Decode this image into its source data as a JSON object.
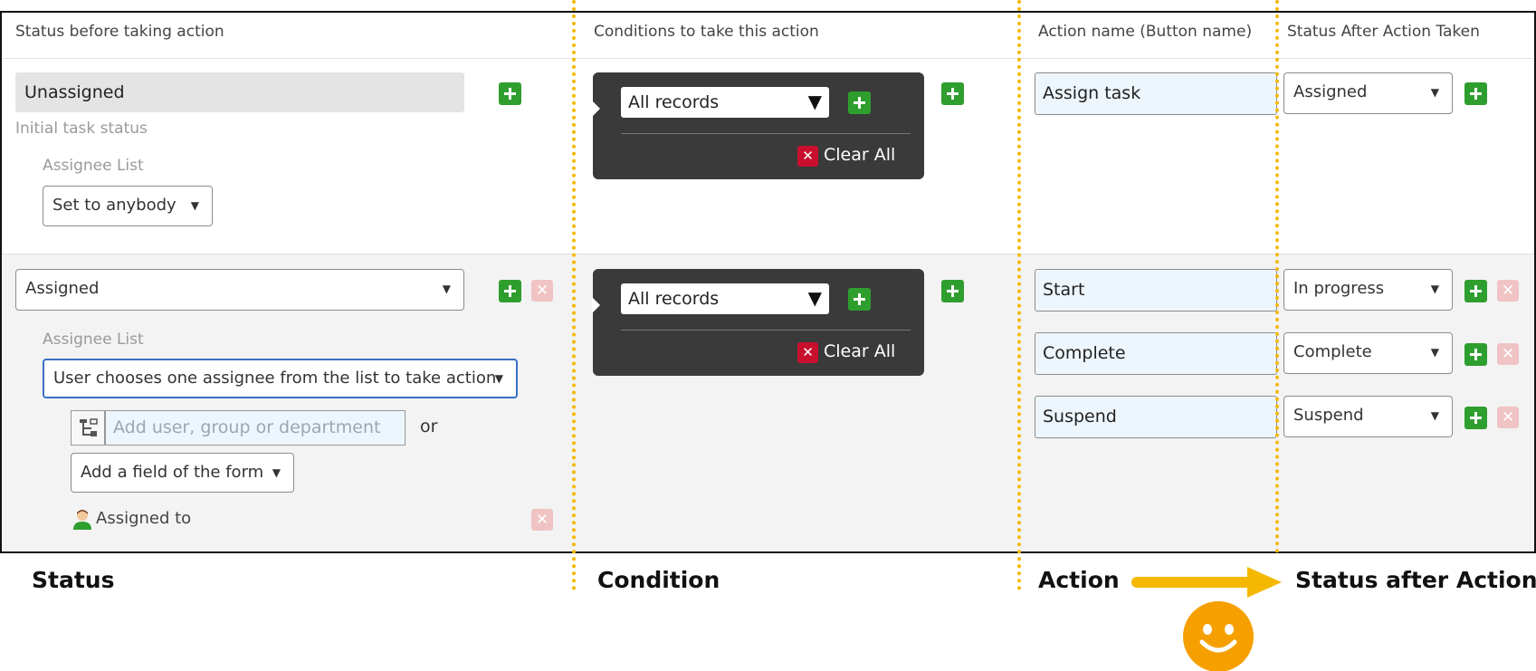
{
  "headers": {
    "status_before": "Status before taking action",
    "conditions": "Conditions to take this action",
    "action_name": "Action name (Button name)",
    "status_after": "Status After Action Taken"
  },
  "row1": {
    "status_value": "Unassigned",
    "status_note": "Initial task status",
    "assignee_label": "Assignee List",
    "assignee_select": "Set to anybody",
    "condition_select": "All records",
    "clear_all": "Clear All",
    "actions": [
      {
        "name": "Assign task",
        "next_status": "Assigned"
      }
    ]
  },
  "row2": {
    "status_select": "Assigned",
    "assignee_label": "Assignee List",
    "assignee_select": "User chooses one assignee from the list to take action",
    "user_placeholder": "Add user, group or department",
    "or_text": "or",
    "field_select": "Add a field of the form",
    "assigned_to": "Assigned to",
    "condition_select": "All records",
    "clear_all": "Clear All",
    "actions": [
      {
        "name": "Start",
        "next_status": "In progress"
      },
      {
        "name": "Complete",
        "next_status": "Complete"
      },
      {
        "name": "Suspend",
        "next_status": "Suspend"
      }
    ]
  },
  "bottom_labels": {
    "status": "Status",
    "condition": "Condition",
    "action": "Action",
    "status_after": "Status after Action"
  },
  "colors": {
    "accent_yellow": "#f5b800",
    "add_green": "#2e9e2e",
    "clear_red": "#c8102e",
    "condition_bg": "#3a3a3a"
  }
}
